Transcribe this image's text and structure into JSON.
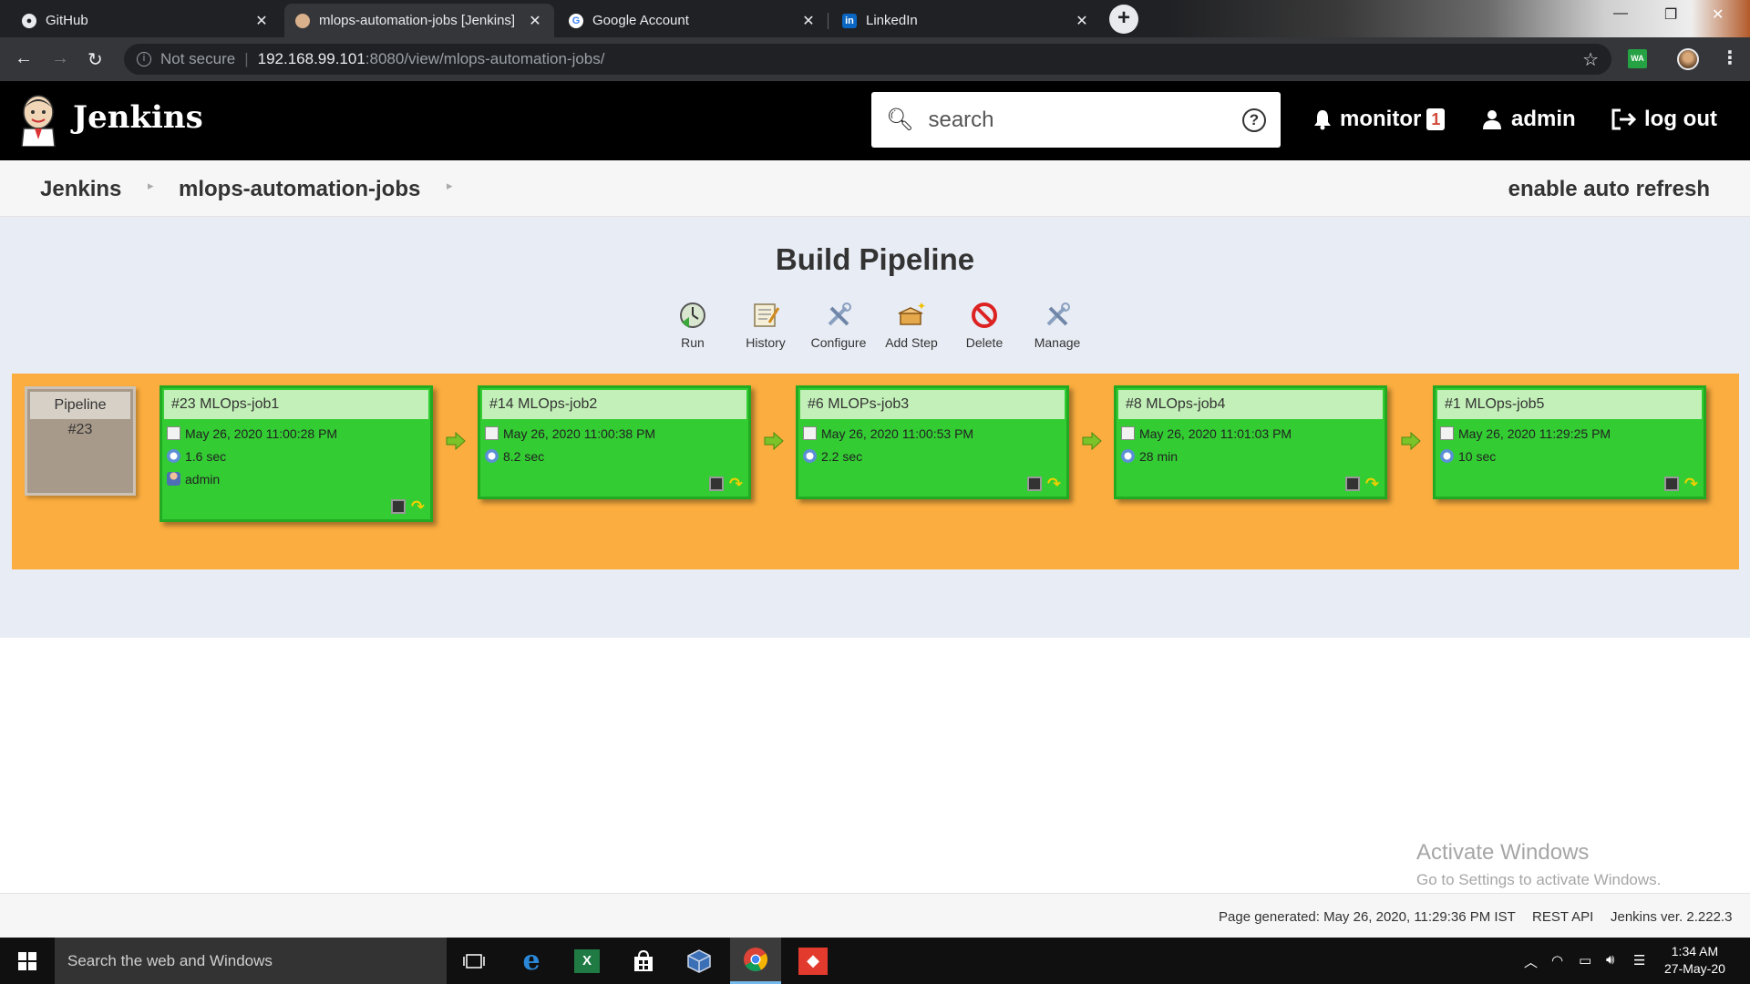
{
  "browser": {
    "tabs": [
      {
        "title": "GitHub",
        "active": false
      },
      {
        "title": "mlops-automation-jobs [Jenkins]",
        "active": true
      },
      {
        "title": "Google Account",
        "active": false
      },
      {
        "title": "LinkedIn",
        "active": false
      }
    ],
    "url_security": "Not secure",
    "url_host": "192.168.99.101",
    "url_path": ":8080/view/mlops-automation-jobs/",
    "ext_label": "WA"
  },
  "header": {
    "title": "Jenkins",
    "search_placeholder": "search",
    "monitor_label": "monitor",
    "monitor_count": "1",
    "user_label": "admin",
    "logout_label": "log out"
  },
  "breadcrumb": {
    "items": [
      "Jenkins",
      "mlops-automation-jobs"
    ],
    "auto_refresh": "enable auto refresh"
  },
  "pipeline": {
    "title": "Build Pipeline",
    "actions": [
      "Run",
      "History",
      "Configure",
      "Add Step",
      "Delete",
      "Manage"
    ],
    "head_label": "Pipeline",
    "head_number": "#23",
    "jobs": [
      {
        "title": "#23 MLOps-job1",
        "date": "May 26, 2020 11:00:28 PM",
        "duration": "1.6 sec",
        "user": "admin"
      },
      {
        "title": "#14 MLOps-job2",
        "date": "May 26, 2020 11:00:38 PM",
        "duration": "8.2 sec"
      },
      {
        "title": "#6 MLOPs-job3",
        "date": "May 26, 2020 11:00:53 PM",
        "duration": "2.2 sec"
      },
      {
        "title": "#8 MLOps-job4",
        "date": "May 26, 2020 11:01:03 PM",
        "duration": "28 min"
      },
      {
        "title": "#1 MLOps-job5",
        "date": "May 26, 2020 11:29:25 PM",
        "duration": "10 sec"
      }
    ],
    "colors": {
      "success": "#33cc33",
      "area": "#fbad3f"
    }
  },
  "watermark": {
    "line1": "Activate Windows",
    "line2": "Go to Settings to activate Windows."
  },
  "footer": {
    "generated": "Page generated: May 26, 2020, 11:29:36 PM IST",
    "rest_api": "REST API",
    "version": "Jenkins ver. 2.222.3"
  },
  "taskbar": {
    "search_placeholder": "Search the web and Windows",
    "time": "1:34 AM",
    "date": "27-May-20"
  }
}
